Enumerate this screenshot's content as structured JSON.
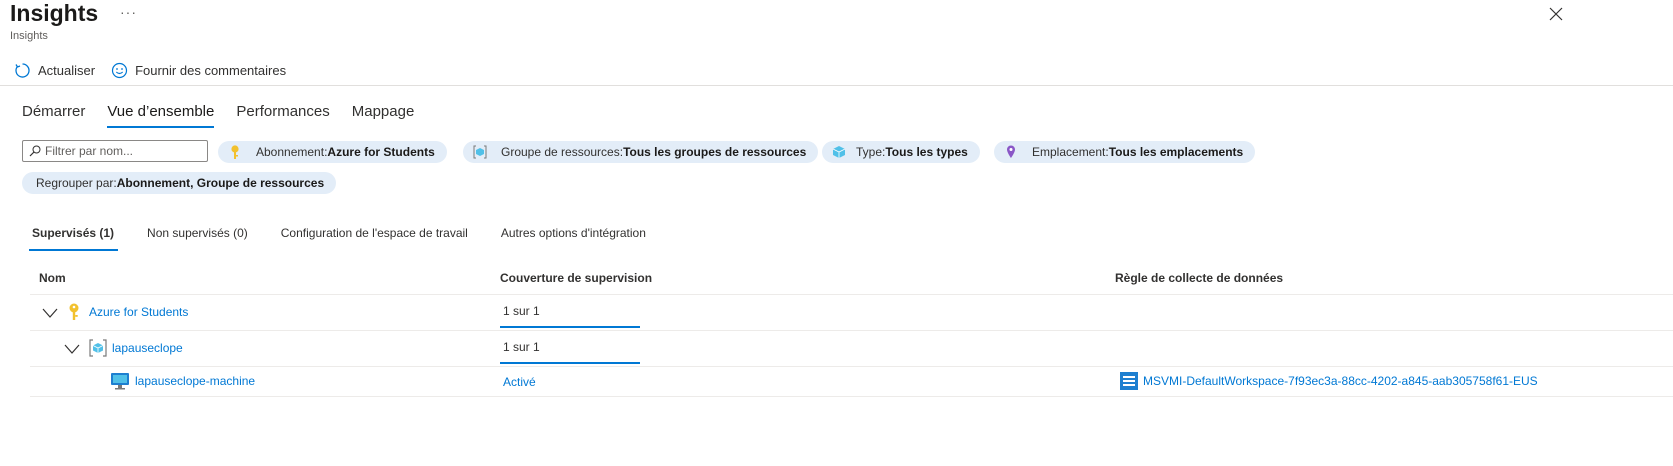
{
  "header": {
    "title": "Insights",
    "more": "···",
    "subtitle": "Insights"
  },
  "toolbar": {
    "refresh_label": "Actualiser",
    "feedback_label": "Fournir des commentaires"
  },
  "nav_tabs": [
    {
      "label": "Démarrer",
      "active": false
    },
    {
      "label": "Vue d’ensemble",
      "active": true
    },
    {
      "label": "Performances",
      "active": false
    },
    {
      "label": "Mappage",
      "active": false
    }
  ],
  "filters": {
    "search_placeholder": "Filtrer par nom...",
    "pills": [
      {
        "key": "Abonnement",
        "value": "Azure for Students",
        "icon": "key-icon"
      },
      {
        "key": "Groupe de ressources",
        "value": "Tous les groupes de ressources",
        "icon": "resource-group-icon"
      },
      {
        "key": "Type",
        "value": "Tous les types",
        "icon": "cube-icon"
      },
      {
        "key": "Emplacement",
        "value": "Tous les emplacements",
        "icon": "location-pin-icon"
      },
      {
        "key": "Regrouper par",
        "value": "Abonnement, Groupe de ressources",
        "icon": ""
      }
    ],
    "separator": " : "
  },
  "sub_tabs": [
    {
      "label": "Supervisés (1)",
      "active": true
    },
    {
      "label": "Non supervisés (0)",
      "active": false
    },
    {
      "label": "Configuration de l'espace de travail",
      "active": false
    },
    {
      "label": "Autres options d'intégration",
      "active": false
    }
  ],
  "table": {
    "columns": [
      "Nom",
      "Couverture de supervision",
      "Règle de collecte de données"
    ],
    "rows": [
      {
        "name": "Azure for Students",
        "icon": "key-icon",
        "coverage": "1 sur 1",
        "coverage_fraction": 1.0,
        "dcr": ""
      },
      {
        "name": "lapauseclope",
        "icon": "resource-group-icon",
        "coverage": "1 sur 1",
        "coverage_fraction": 1.0,
        "dcr": ""
      },
      {
        "name": "lapauseclope-machine",
        "icon": "virtual-machine-icon",
        "coverage": "Activé",
        "dcr": "MSVMI-DefaultWorkspace-7f93ec3a-88cc-4202-a845-aab305758f61-EUS"
      }
    ]
  },
  "colors": {
    "accent": "#0078d4",
    "pill_bg": "#e3edf8",
    "key": "#f2c12e",
    "location": "#8a57c7"
  }
}
